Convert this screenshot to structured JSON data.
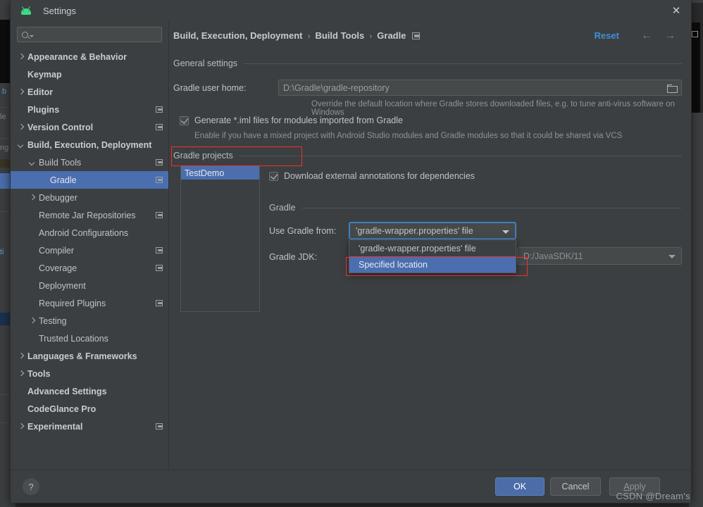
{
  "window": {
    "title": "Settings",
    "app_icon": "android-logo-icon",
    "close_icon": "✕"
  },
  "sidebar": {
    "search": {
      "placeholder": "",
      "value": "",
      "icon": "search-icon"
    },
    "items": [
      {
        "label": "Appearance & Behavior",
        "arrow": "right",
        "indent": 0,
        "bold": true,
        "badge": false,
        "selected": false
      },
      {
        "label": "Keymap",
        "arrow": "none",
        "indent": 0,
        "bold": true,
        "badge": false,
        "selected": false
      },
      {
        "label": "Editor",
        "arrow": "right",
        "indent": 0,
        "bold": true,
        "badge": false,
        "selected": false
      },
      {
        "label": "Plugins",
        "arrow": "none",
        "indent": 0,
        "bold": true,
        "badge": true,
        "selected": false
      },
      {
        "label": "Version Control",
        "arrow": "right",
        "indent": 0,
        "bold": true,
        "badge": true,
        "selected": false
      },
      {
        "label": "Build, Execution, Deployment",
        "arrow": "down",
        "indent": 0,
        "bold": true,
        "badge": false,
        "selected": false
      },
      {
        "label": "Build Tools",
        "arrow": "down",
        "indent": 1,
        "bold": false,
        "badge": true,
        "selected": false
      },
      {
        "label": "Gradle",
        "arrow": "none",
        "indent": 2,
        "bold": false,
        "badge": true,
        "selected": true
      },
      {
        "label": "Debugger",
        "arrow": "right",
        "indent": 1,
        "bold": false,
        "badge": false,
        "selected": false
      },
      {
        "label": "Remote Jar Repositories",
        "arrow": "none",
        "indent": 1,
        "bold": false,
        "badge": true,
        "selected": false
      },
      {
        "label": "Android Configurations",
        "arrow": "none",
        "indent": 1,
        "bold": false,
        "badge": false,
        "selected": false
      },
      {
        "label": "Compiler",
        "arrow": "none",
        "indent": 1,
        "bold": false,
        "badge": true,
        "selected": false
      },
      {
        "label": "Coverage",
        "arrow": "none",
        "indent": 1,
        "bold": false,
        "badge": true,
        "selected": false
      },
      {
        "label": "Deployment",
        "arrow": "none",
        "indent": 1,
        "bold": false,
        "badge": false,
        "selected": false
      },
      {
        "label": "Required Plugins",
        "arrow": "none",
        "indent": 1,
        "bold": false,
        "badge": true,
        "selected": false
      },
      {
        "label": "Testing",
        "arrow": "right",
        "indent": 1,
        "bold": false,
        "badge": false,
        "selected": false
      },
      {
        "label": "Trusted Locations",
        "arrow": "none",
        "indent": 1,
        "bold": false,
        "badge": false,
        "selected": false
      },
      {
        "label": "Languages & Frameworks",
        "arrow": "right",
        "indent": 0,
        "bold": true,
        "badge": false,
        "selected": false
      },
      {
        "label": "Tools",
        "arrow": "right",
        "indent": 0,
        "bold": true,
        "badge": false,
        "selected": false
      },
      {
        "label": "Advanced Settings",
        "arrow": "none",
        "indent": 0,
        "bold": true,
        "badge": false,
        "selected": false
      },
      {
        "label": "CodeGlance Pro",
        "arrow": "none",
        "indent": 0,
        "bold": true,
        "badge": false,
        "selected": false
      },
      {
        "label": "Experimental",
        "arrow": "right",
        "indent": 0,
        "bold": true,
        "badge": true,
        "selected": false
      }
    ]
  },
  "header": {
    "breadcrumb": [
      "Build, Execution, Deployment",
      "Build Tools",
      "Gradle"
    ],
    "separator": "›",
    "project_badge_icon": "project-scope-icon",
    "reset_label": "Reset",
    "back_icon": "←",
    "forward_icon": "→"
  },
  "general": {
    "section_title": "General settings",
    "gradle_user_home_label": "Gradle user home:",
    "gradle_user_home_value": "D:\\Gradle\\gradle-repository",
    "browse_icon": "folder-icon",
    "gradle_user_home_hint": "Override the default location where Gradle stores downloaded files, e.g. to tune anti-virus software on Windows",
    "generate_iml_label": "Generate *.iml files for modules imported from Gradle",
    "generate_iml_checked": true,
    "generate_iml_hint": "Enable if you have a mixed project with Android Studio modules and Gradle modules so that it could be shared via VCS"
  },
  "projects": {
    "section_title": "Gradle projects",
    "items": [
      {
        "label": "TestDemo",
        "selected": true
      }
    ]
  },
  "gradle": {
    "download_annotations_label": "Download external annotations for dependencies",
    "download_annotations_checked": true,
    "section_title": "Gradle",
    "use_gradle_from_label": "Use Gradle from:",
    "use_gradle_from_value": "'gradle-wrapper.properties' file",
    "dropdown_options": [
      {
        "label": "'gradle-wrapper.properties' file",
        "selected": false
      },
      {
        "label": "Specified location",
        "selected": true
      }
    ],
    "gradle_jdk_label": "Gradle JDK:",
    "gradle_jdk_value": "D:/JavaSDK/11"
  },
  "footer": {
    "help_label": "?",
    "ok_label": "OK",
    "cancel_label": "Cancel",
    "apply_label_first": "A",
    "apply_label_rest": "pply"
  },
  "watermark": "CSDN @Dream's",
  "background": {
    "editor_hints": [
      "b",
      "le",
      "ng",
      "ti"
    ]
  },
  "colors": {
    "accent_selection": "#4b6eaf",
    "link": "#3f8fd9",
    "highlight_box": "#f03030",
    "panel_bg": "#3c3f41",
    "editor_bg": "#2b2b2b"
  }
}
